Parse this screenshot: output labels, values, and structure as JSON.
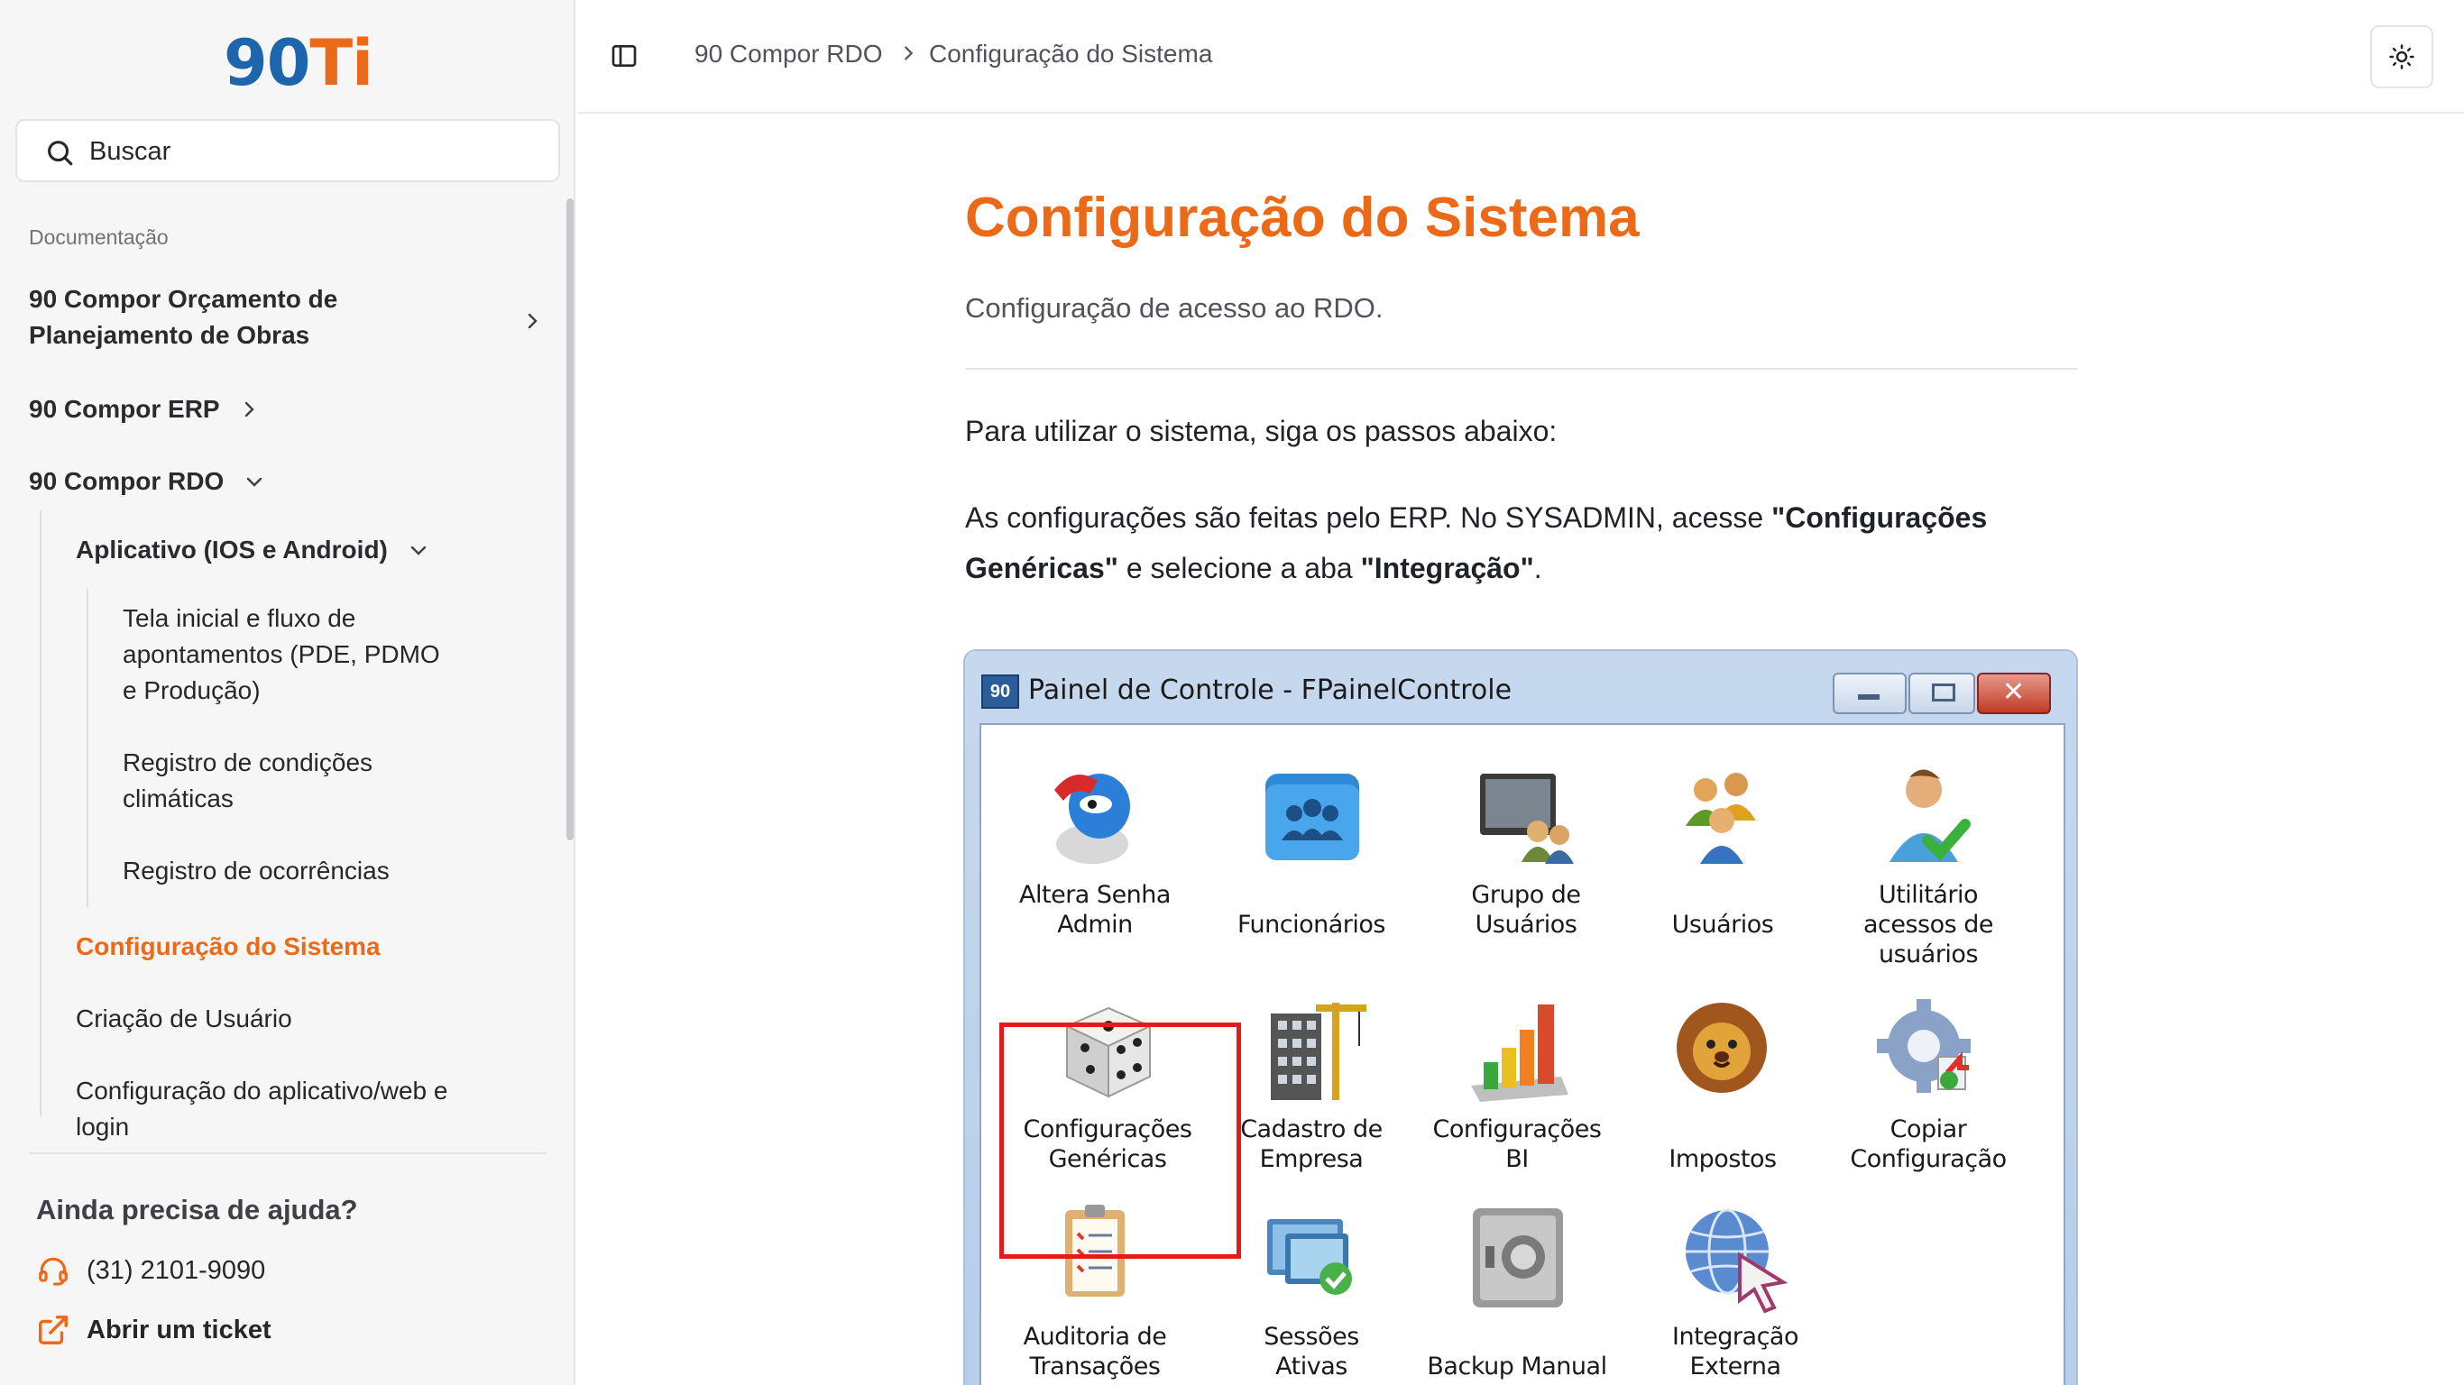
{
  "logo": {
    "numeric": "90",
    "suffix": "Ti"
  },
  "search": {
    "label": "Buscar"
  },
  "nav": {
    "section": "Documentação",
    "orcamento_line1": "90 Compor Orçamento de",
    "orcamento_line2": "Planejamento de Obras",
    "erp": "90 Compor ERP",
    "rdo": "90 Compor RDO",
    "aplicativo": "Aplicativo (IOS e Android)",
    "tela_line1": "Tela inicial e fluxo de",
    "tela_line2": "apontamentos (PDE, PDMO",
    "tela_line3": "e Produção)",
    "registro_cond_line1": "Registro de condições",
    "registro_cond_line2": "climáticas",
    "registro_ocorr": "Registro de ocorrências",
    "config_sistema": "Configuração do Sistema",
    "criacao_usuario": "Criação de Usuário",
    "config_app_line1": "Configuração do aplicativo/web e",
    "config_app_line2": "login"
  },
  "help": {
    "title": "Ainda precisa de ajuda?",
    "phone": "(31) 2101-9090",
    "ticket": "Abrir um ticket"
  },
  "breadcrumb": {
    "parent": "90 Compor RDO",
    "current": "Configuração do Sistema"
  },
  "page": {
    "title": "Configuração do Sistema",
    "subtitle": "Configuração de acesso ao RDO.",
    "intro": "Para utilizar o sistema, siga os passos abaixo:",
    "p2_a": "As configurações são feitas pelo ERP. No SYSADMIN, acesse ",
    "p2_b": "\"Configurações Genéricas\"",
    "p2_c": " e selecione a aba ",
    "p2_d": "\"Integração\"",
    "p2_e": "."
  },
  "window": {
    "icon_text": "90",
    "title": "Painel de Controle - FPainelControle",
    "tiles": [
      {
        "l1": "Altera Senha",
        "l2": "Admin",
        "l3": "",
        "icon": "key-lock-icon"
      },
      {
        "l1": "Funcionários",
        "l2": "",
        "l3": "",
        "icon": "people-folder-icon"
      },
      {
        "l1": "Grupo de",
        "l2": "Usuários",
        "l3": "",
        "icon": "user-group-monitor-icon"
      },
      {
        "l1": "Usuários",
        "l2": "",
        "l3": "",
        "icon": "users-icon"
      },
      {
        "l1": "Utilitário",
        "l2": "acessos de",
        "l3": "usuários",
        "icon": "user-check-icon"
      },
      {
        "l1": "Configurações",
        "l2": "Genéricas",
        "l3": "",
        "icon": "dice-icon"
      },
      {
        "l1": "Cadastro de",
        "l2": "Empresa",
        "l3": "",
        "icon": "building-icon"
      },
      {
        "l1": "Configurações",
        "l2": "BI",
        "l3": "",
        "icon": "bar-chart-icon"
      },
      {
        "l1": "Impostos",
        "l2": "",
        "l3": "",
        "icon": "lion-icon"
      },
      {
        "l1": "Copiar",
        "l2": "Configuração",
        "l3": "",
        "icon": "gear-copy-icon"
      },
      {
        "l1": "Auditoria de",
        "l2": "Transações",
        "l3": "",
        "icon": "clipboard-icon"
      },
      {
        "l1": "Sessões",
        "l2": "Ativas",
        "l3": "",
        "icon": "sessions-icon"
      },
      {
        "l1": "Backup Manual",
        "l2": "",
        "l3": "",
        "icon": "safe-icon"
      },
      {
        "l1": "Integração",
        "l2": "Externa",
        "l3": "",
        "icon": "globe-cursor-icon"
      }
    ]
  },
  "colors": {
    "accent": "#ec6a17",
    "brand_blue": "#1d65ad"
  }
}
